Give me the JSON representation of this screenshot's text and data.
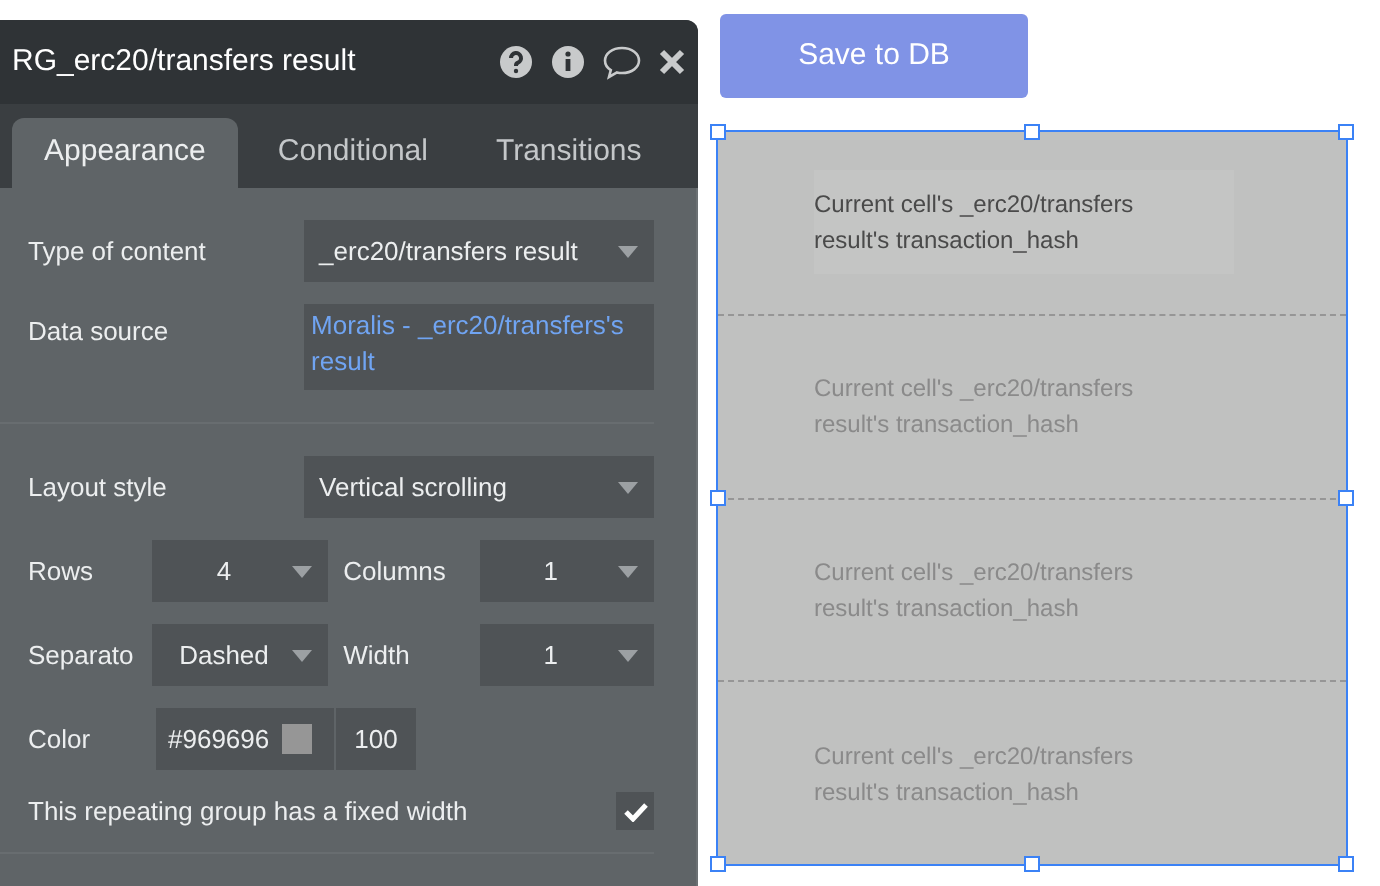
{
  "panel": {
    "title": "RG_erc20/transfers result",
    "tabs": [
      {
        "label": "Appearance",
        "selected": true
      },
      {
        "label": "Conditional",
        "selected": false
      },
      {
        "label": "Transitions",
        "selected": false
      }
    ],
    "type_of_content": {
      "label": "Type of content",
      "value": "_erc20/transfers result"
    },
    "data_source": {
      "label": "Data source",
      "value": "Moralis - _erc20/transfers's result"
    },
    "layout_style": {
      "label": "Layout style",
      "value": "Vertical scrolling"
    },
    "rows": {
      "label": "Rows",
      "value": "4"
    },
    "columns": {
      "label": "Columns",
      "value": "1"
    },
    "separator": {
      "label": "Separato",
      "value": "Dashed"
    },
    "width": {
      "label": "Width",
      "value": "1"
    },
    "color": {
      "label": "Color",
      "hex": "#969696",
      "color": "#969696",
      "opacity": "100"
    },
    "fixed_width": {
      "label": "This repeating group has a fixed width",
      "checked": true
    }
  },
  "save_button": "Save to DB",
  "cells": [
    {
      "text": "Current cell's _erc20/transfers result's transaction_hash",
      "active": true
    },
    {
      "text": "Current cell's _erc20/transfers result's transaction_hash",
      "active": false
    },
    {
      "text": "Current cell's _erc20/transfers result's transaction_hash",
      "active": false
    },
    {
      "text": "Current cell's _erc20/transfers result's transaction_hash",
      "active": false
    }
  ]
}
